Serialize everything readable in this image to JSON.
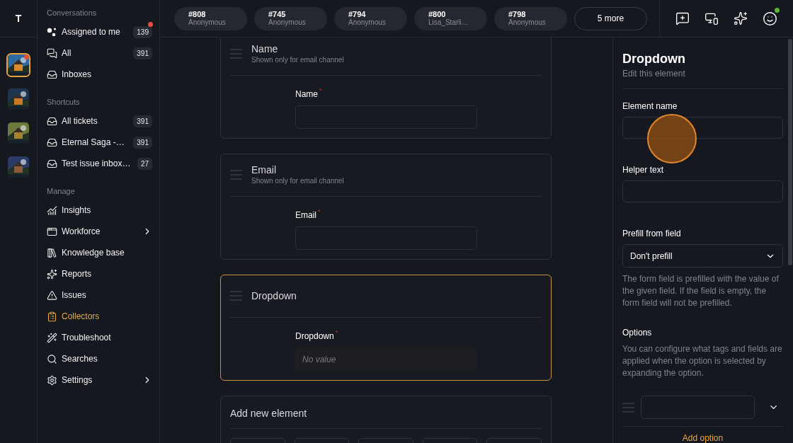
{
  "workspace_rail": {
    "initial": "T",
    "workspaces": [
      {
        "kind": "picture",
        "selected": true,
        "unread": true
      },
      {
        "kind": "picture",
        "selected": false,
        "unread": false
      },
      {
        "kind": "picture",
        "selected": false,
        "unread": false
      },
      {
        "kind": "picture",
        "selected": false,
        "unread": false
      }
    ]
  },
  "sidebar": {
    "sections": [
      {
        "title": "Conversations",
        "items": [
          {
            "label": "Assigned to me",
            "count": "139",
            "unread": true,
            "selected": false,
            "expandable": false
          },
          {
            "label": "All",
            "count": "391",
            "unread": false,
            "selected": false,
            "expandable": false
          },
          {
            "label": "Inboxes",
            "unread": false,
            "selected": false,
            "expandable": false
          }
        ]
      },
      {
        "title": "Shortcuts",
        "items": [
          {
            "label": "All tickets",
            "count": "391",
            "unread": false,
            "selected": false,
            "expandable": false
          },
          {
            "label": "Eternal Saga -…",
            "count": "391",
            "unread": false,
            "selected": false,
            "expandable": false
          },
          {
            "label": "Test issue inbox…",
            "count": "27",
            "unread": false,
            "selected": false,
            "expandable": false
          }
        ]
      },
      {
        "title": "Manage",
        "items": [
          {
            "label": "Insights",
            "unread": false,
            "selected": false,
            "expandable": false
          },
          {
            "label": "Workforce",
            "unread": false,
            "selected": false,
            "expandable": true
          },
          {
            "label": "Knowledge base",
            "unread": false,
            "selected": false,
            "expandable": false
          },
          {
            "label": "Reports",
            "unread": false,
            "selected": false,
            "expandable": false
          },
          {
            "label": "Issues",
            "unread": false,
            "selected": false,
            "expandable": false
          },
          {
            "label": "Collectors",
            "unread": false,
            "selected": true,
            "expandable": false
          },
          {
            "label": "Troubleshoot",
            "unread": false,
            "selected": false,
            "expandable": false
          },
          {
            "label": "Searches",
            "unread": false,
            "selected": false,
            "expandable": false
          },
          {
            "label": "Settings",
            "unread": false,
            "selected": false,
            "expandable": true
          }
        ]
      }
    ]
  },
  "ticket_tabs": [
    {
      "number": "#808",
      "name": "Anonymous"
    },
    {
      "number": "#745",
      "name": "Anonymous"
    },
    {
      "number": "#794",
      "name": "Anonymous"
    },
    {
      "number": "#800",
      "name": "Lisa_Starli…"
    },
    {
      "number": "#798",
      "name": "Anonymous"
    }
  ],
  "more_tabs": "5 more",
  "top_actions": {
    "online": true
  },
  "form_elements": [
    {
      "kind": "text",
      "title": "Name",
      "subtitle": "Shown only for email channel",
      "label": "Name",
      "required_mark": "*",
      "selected": false
    },
    {
      "kind": "text",
      "title": "Email",
      "subtitle": "Shown only for email channel",
      "label": "Email",
      "required_mark": "*",
      "selected": false
    },
    {
      "kind": "dropdown",
      "title": "Dropdown",
      "label": "Dropdown",
      "required_mark": "*",
      "placeholder": "No value",
      "selected": true
    }
  ],
  "add_element": {
    "title": "Add new element"
  },
  "editor": {
    "title": "Dropdown",
    "subtitle": "Edit this element",
    "element_name": {
      "label": "Element name"
    },
    "helper_text": {
      "label": "Helper text"
    },
    "prefill": {
      "label": "Prefill from field",
      "value": "Don't prefill",
      "hint": "The form field is prefilled with the value of the given field. If the field is empty, the form field will not be prefilled."
    },
    "options": {
      "title": "Options",
      "hint": "You can configure what tags and fields are applied when the option is selected by expanding the option.",
      "add_label": "Add option"
    }
  }
}
